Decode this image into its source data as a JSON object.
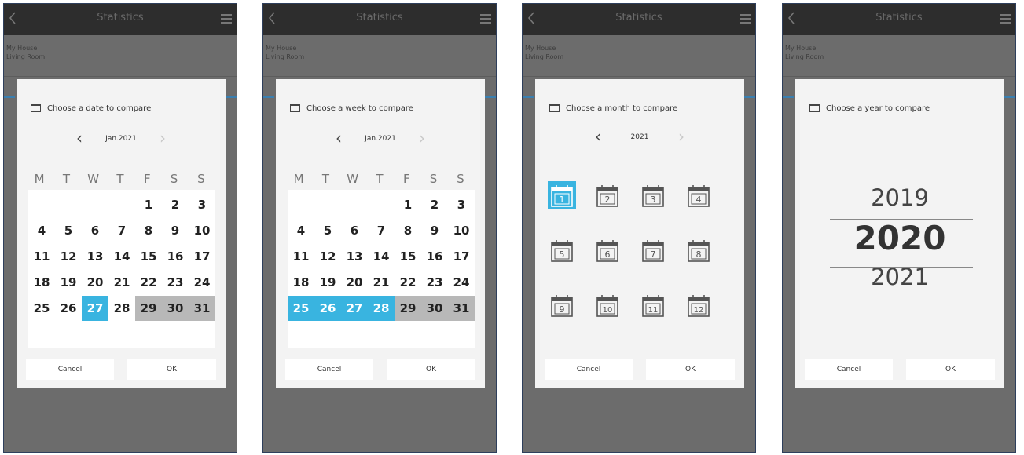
{
  "screens": [
    {
      "kind": "day",
      "title": "Statistics",
      "house": "My House",
      "room": "Living Room",
      "dialog_title": "Choose a date to compare",
      "nav_label": "Jan.2021",
      "weekdays": [
        "M",
        "T",
        "W",
        "T",
        "F",
        "S",
        "S"
      ],
      "days": [
        [
          "",
          "",
          "",
          "",
          "1",
          "2",
          "3"
        ],
        [
          "4",
          "5",
          "6",
          "7",
          "8",
          "9",
          "10"
        ],
        [
          "11",
          "12",
          "13",
          "14",
          "15",
          "16",
          "17"
        ],
        [
          "18",
          "19",
          "20",
          "21",
          "22",
          "23",
          "24"
        ],
        [
          "25",
          "26",
          "27",
          "28",
          "29",
          "30",
          "31"
        ]
      ],
      "selected_days": [
        "27"
      ],
      "disabled_days": [
        "29",
        "30",
        "31"
      ],
      "cancel_label": "Cancel",
      "ok_label": "OK"
    },
    {
      "kind": "week",
      "title": "Statistics",
      "house": "My House",
      "room": "Living Room",
      "dialog_title": "Choose a week to compare",
      "nav_label": "Jan.2021",
      "weekdays": [
        "M",
        "T",
        "W",
        "T",
        "F",
        "S",
        "S"
      ],
      "days": [
        [
          "",
          "",
          "",
          "",
          "1",
          "2",
          "3"
        ],
        [
          "4",
          "5",
          "6",
          "7",
          "8",
          "9",
          "10"
        ],
        [
          "11",
          "12",
          "13",
          "14",
          "15",
          "16",
          "17"
        ],
        [
          "18",
          "19",
          "20",
          "21",
          "22",
          "23",
          "24"
        ],
        [
          "25",
          "26",
          "27",
          "28",
          "29",
          "30",
          "31"
        ]
      ],
      "selected_days": [
        "25",
        "26",
        "27",
        "28"
      ],
      "disabled_days": [
        "29",
        "30",
        "31"
      ],
      "cancel_label": "Cancel",
      "ok_label": "OK"
    },
    {
      "kind": "month",
      "title": "Statistics",
      "house": "My House",
      "room": "Living Room",
      "dialog_title": "Choose a month to compare",
      "nav_label": "2021",
      "months": [
        "1",
        "2",
        "3",
        "4",
        "5",
        "6",
        "7",
        "8",
        "9",
        "10",
        "11",
        "12"
      ],
      "selected_month": "1",
      "cancel_label": "Cancel",
      "ok_label": "OK"
    },
    {
      "kind": "year",
      "title": "Statistics",
      "house": "My House",
      "room": "Living Room",
      "dialog_title": "Choose a year to compare",
      "years": [
        "2019",
        "2020",
        "2021"
      ],
      "selected_year": "2020",
      "cancel_label": "Cancel",
      "ok_label": "OK"
    }
  ],
  "colors": {
    "selected": "#39b4e0",
    "disabled": "#b8b8b8",
    "topbar": "#2d2d2d",
    "overlay": "#6c6c6c"
  }
}
